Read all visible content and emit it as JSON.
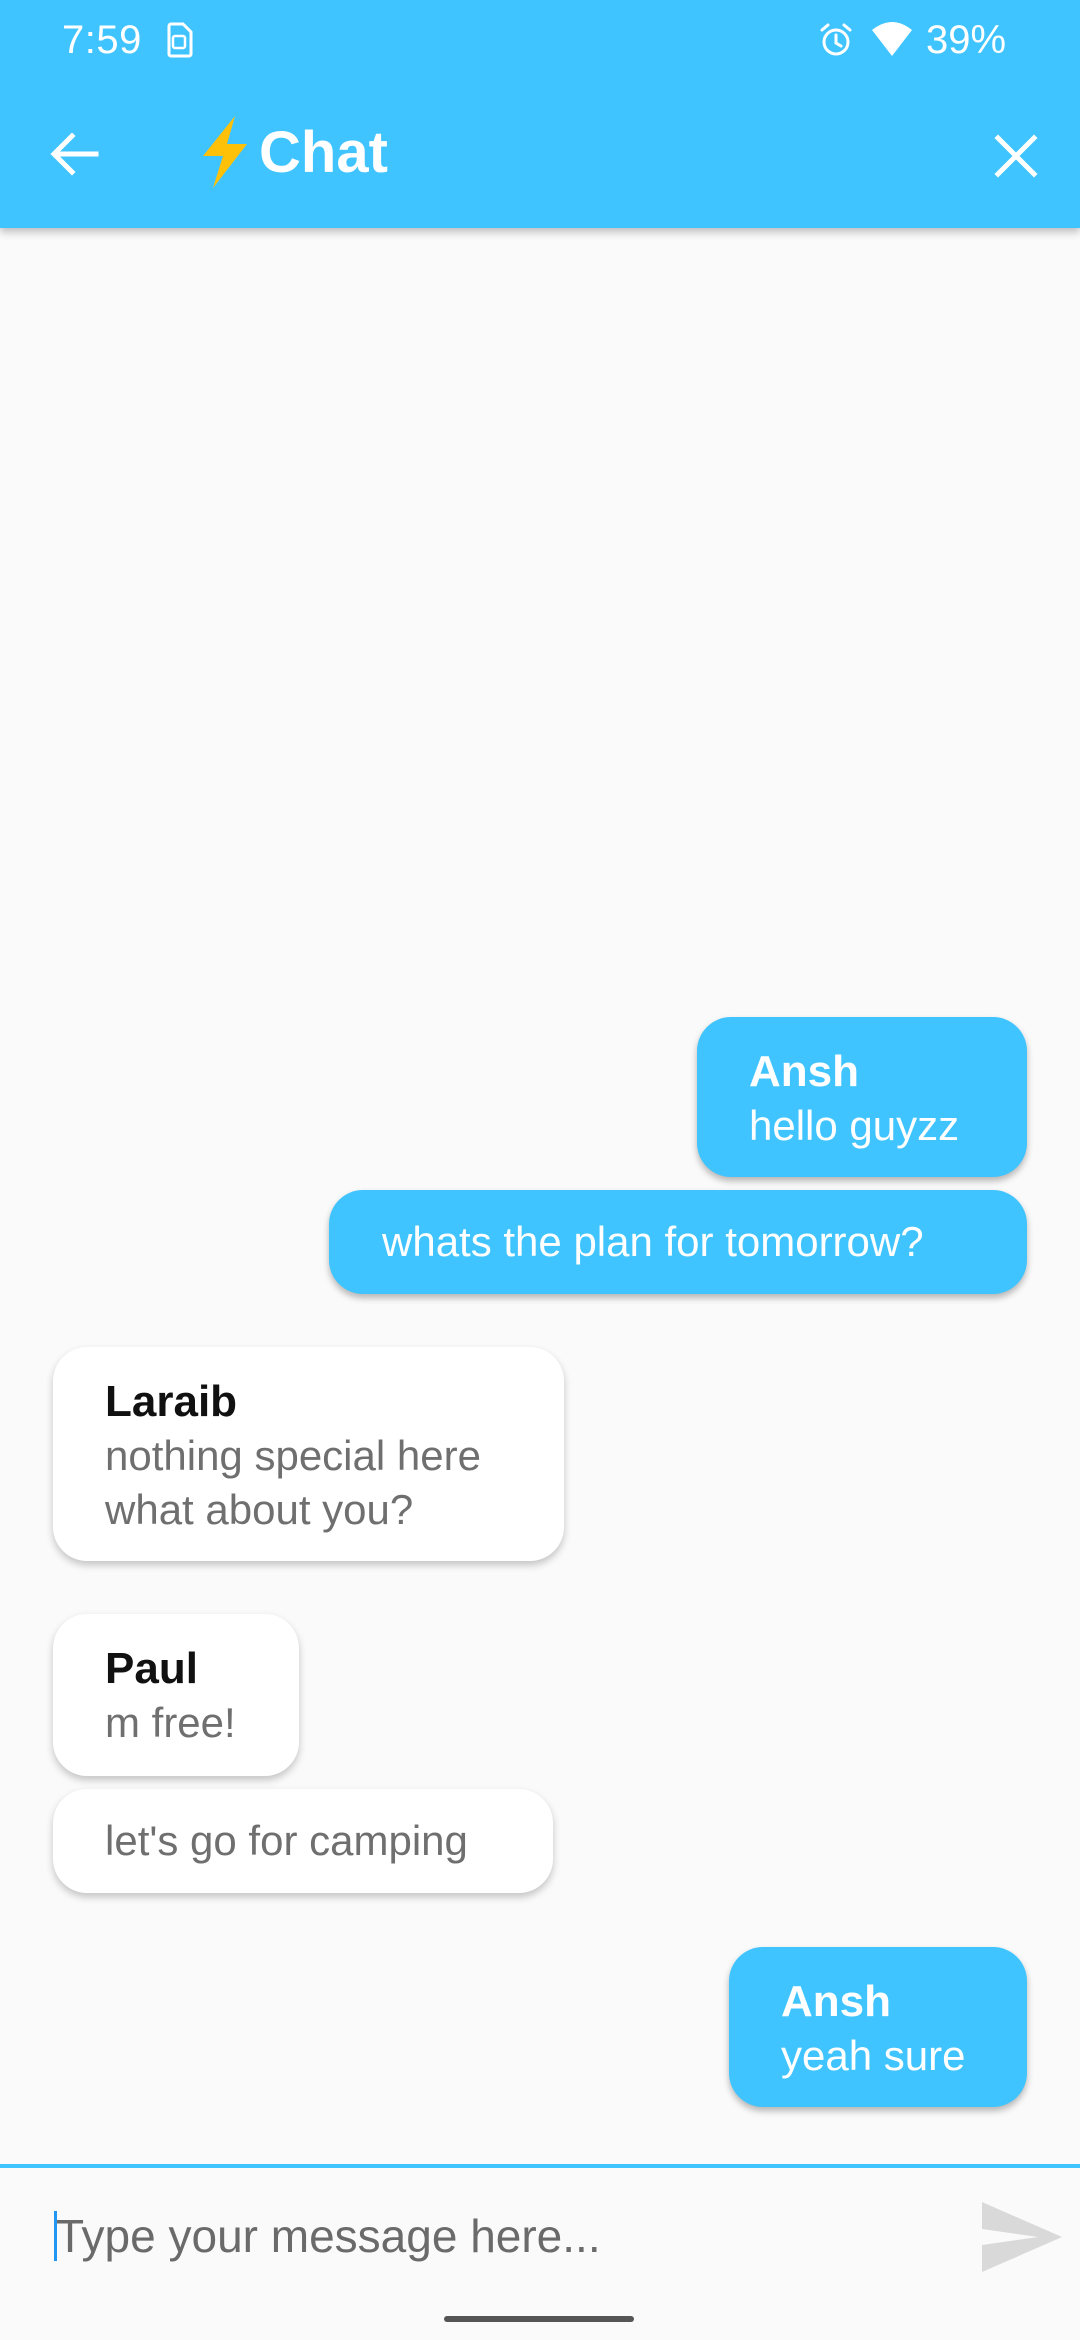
{
  "status_bar": {
    "time": "7:59",
    "battery": "39%",
    "icons": [
      "sim-icon",
      "alarm-icon",
      "wifi-icon"
    ]
  },
  "app_bar": {
    "title": "Chat",
    "title_emoji": "⚡",
    "back_icon": "arrow-left-icon",
    "close_icon": "close-icon",
    "color": "#40c4ff"
  },
  "messages": [
    {
      "sender": "Ansh",
      "text": "hello guyzz",
      "direction": "outgoing"
    },
    {
      "sender": "",
      "text": "whats the plan for tomorrow?",
      "direction": "outgoing"
    },
    {
      "sender": "Laraib",
      "text": "nothing special here what about you?",
      "direction": "incoming"
    },
    {
      "sender": "Paul",
      "text": "m free!",
      "direction": "incoming"
    },
    {
      "sender": "",
      "text": "let's go for camping",
      "direction": "incoming"
    },
    {
      "sender": "Ansh",
      "text": "yeah sure",
      "direction": "outgoing"
    }
  ],
  "composer": {
    "placeholder": "Type your message here...",
    "value": "",
    "send_icon": "send-icon"
  },
  "colors": {
    "accent": "#40c4ff",
    "background": "#fafafa",
    "incoming_bubble": "#ffffff"
  }
}
